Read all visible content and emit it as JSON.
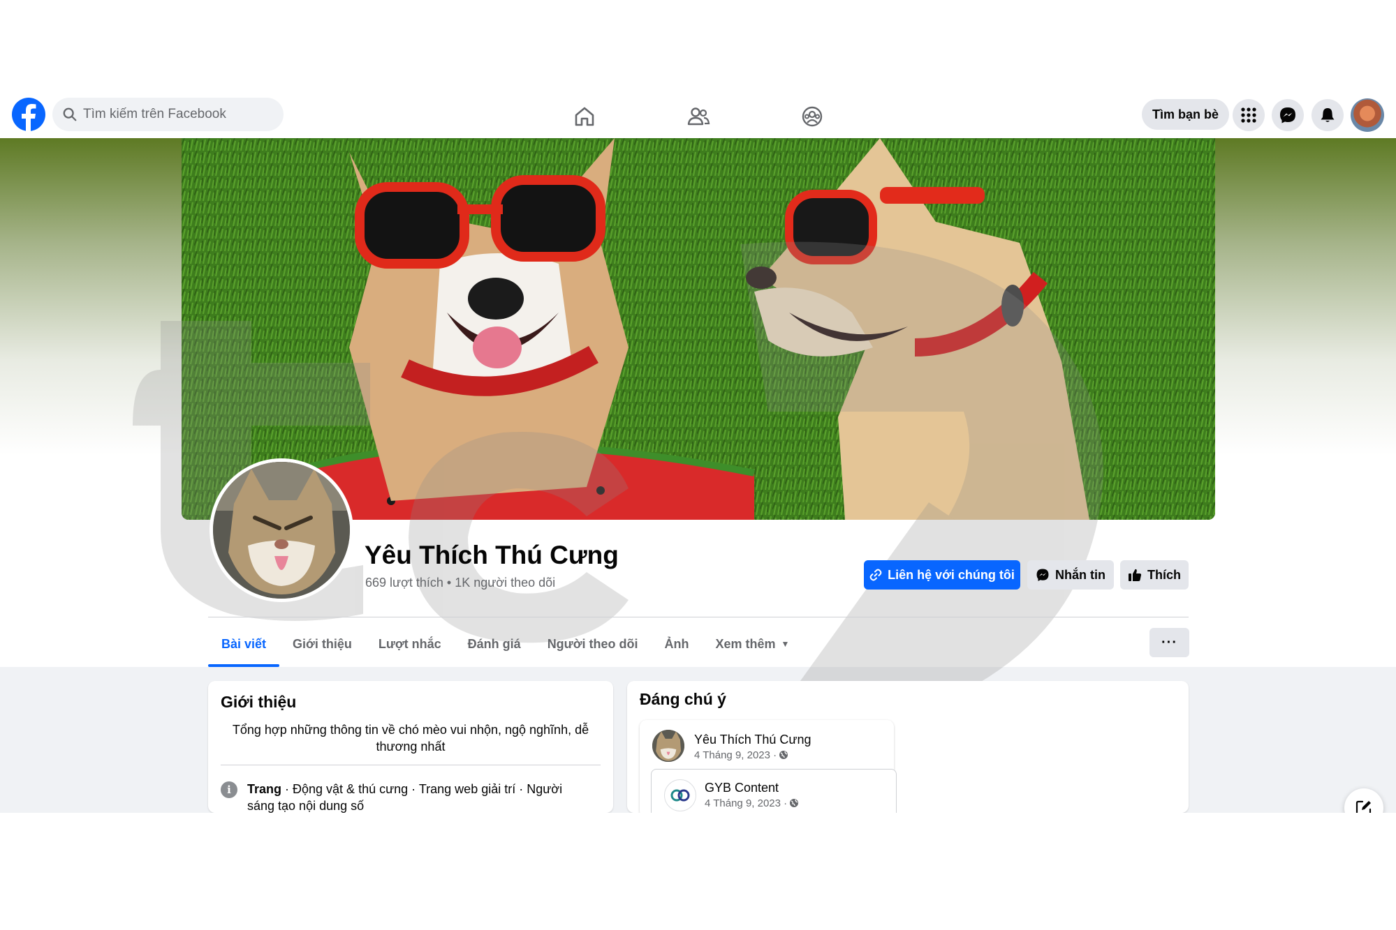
{
  "topnav": {
    "search_placeholder": "Tìm kiếm trên Facebook",
    "find_friends": "Tìm bạn bè",
    "icons": [
      "facebook-logo-icon",
      "search-icon",
      "home-icon",
      "friends-icon",
      "groups-icon",
      "menu-grid-icon",
      "messenger-icon",
      "bell-icon",
      "avatar"
    ]
  },
  "page": {
    "name": "Yêu Thích Thú Cưng",
    "stats": "669 lượt thích • 1K người theo dõi"
  },
  "actions": {
    "contact": "Liên hệ với chúng tôi",
    "message": "Nhắn tin",
    "like": "Thích"
  },
  "tabs": [
    {
      "label": "Bài viết",
      "active": true
    },
    {
      "label": "Giới thiệu"
    },
    {
      "label": "Lượt nhắc"
    },
    {
      "label": "Đánh giá"
    },
    {
      "label": "Người theo dõi"
    },
    {
      "label": "Ảnh"
    },
    {
      "label": "Xem thêm"
    }
  ],
  "more_button": "···",
  "intro": {
    "title": "Giới thiệu",
    "description": "Tổng hợp những thông tin về chó mèo vui nhộn, ngộ nghĩnh, dễ thương nhất",
    "category_label": "Trang",
    "category_text": " · Động vật & thú cưng · Trang web giải trí · Người sáng tạo nội dung số"
  },
  "notable": {
    "title": "Đáng chú ý",
    "post": {
      "author": "Yêu Thích Thú Cưng",
      "date": "4 Tháng 9, 2023 ·"
    },
    "shared": {
      "author": "GYB Content",
      "date": "4 Tháng 9, 2023 ·"
    }
  },
  "colors": {
    "brand": "#0866ff",
    "secondary_button": "#e4e6eb",
    "text_muted": "#65676b",
    "feed_background": "#f0f2f5"
  }
}
